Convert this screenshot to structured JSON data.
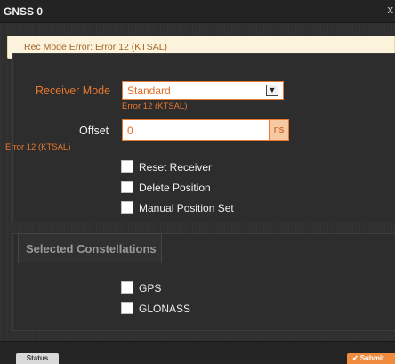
{
  "window": {
    "title": "GNSS 0",
    "close_label": "x"
  },
  "alert": {
    "message": "Rec Mode Error: Error 12 (KTSAL)"
  },
  "receiver_mode": {
    "label": "Receiver Mode",
    "value": "Standard",
    "error": "Error 12 (KTSAL)",
    "arrow_icon": "chevron-down-icon"
  },
  "offset": {
    "label": "Offset",
    "value": "0",
    "unit": "ns",
    "error": "Error 12 (KTSAL)"
  },
  "options": [
    {
      "label": "Reset Receiver",
      "checked": false
    },
    {
      "label": "Delete Position",
      "checked": false
    },
    {
      "label": "Manual Position Set",
      "checked": false
    }
  ],
  "constellations": {
    "title": "Selected Constellations",
    "items": [
      {
        "label": "GPS",
        "checked": false
      },
      {
        "label": "GLONASS",
        "checked": false
      }
    ]
  },
  "footer": {
    "status_label": "Status",
    "submit_label": "Submit",
    "submit_icon": "check-icon"
  },
  "colors": {
    "error_orange": "#e8772f",
    "alert_bg": "#fcf3dc",
    "background": "#2f2f2f"
  }
}
